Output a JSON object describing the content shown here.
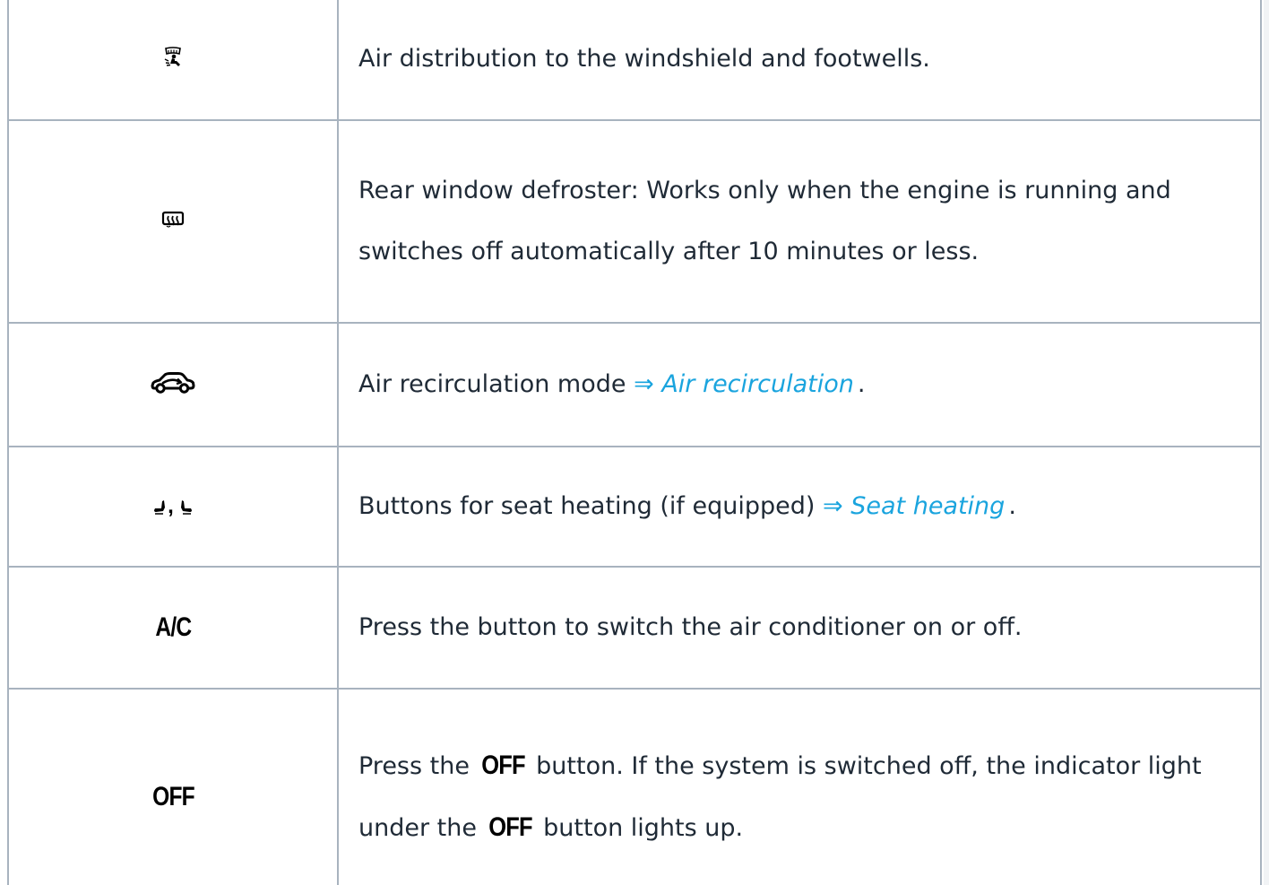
{
  "rows": [
    {
      "icon": "windshield-footwell-distribution-icon",
      "description": "Air distribution to the windshield and footwells."
    },
    {
      "icon": "rear-window-defroster-icon",
      "description": "Rear window defroster: Works only when the engine is running and switches off automatically after 10 minutes or less."
    },
    {
      "icon": "air-recirculation-car-icon",
      "description_prefix": "Air recirculation mode",
      "link": "⇒ Air recirculation",
      "suffix": "."
    },
    {
      "icon": "seat-heating-icons",
      "icon_separator": ",",
      "description_prefix": "Buttons for seat heating (if equipped)",
      "link": "⇒ Seat heating",
      "suffix": "."
    },
    {
      "icon": "ac-button-label",
      "icon_label": "A/C",
      "description": "Press the button to switch the air conditioner on or off."
    },
    {
      "icon": "off-button-label",
      "icon_label": "OFF",
      "description_part1": "Press the",
      "inline_label_1": "OFF",
      "description_part2": "button. If the system is switched off, the indicator light under the",
      "inline_label_2": "OFF",
      "description_part3": "button lights up."
    }
  ],
  "colors": {
    "link": "#1aa4de",
    "border": "#a8b3bf",
    "text": "#1f2a36"
  }
}
